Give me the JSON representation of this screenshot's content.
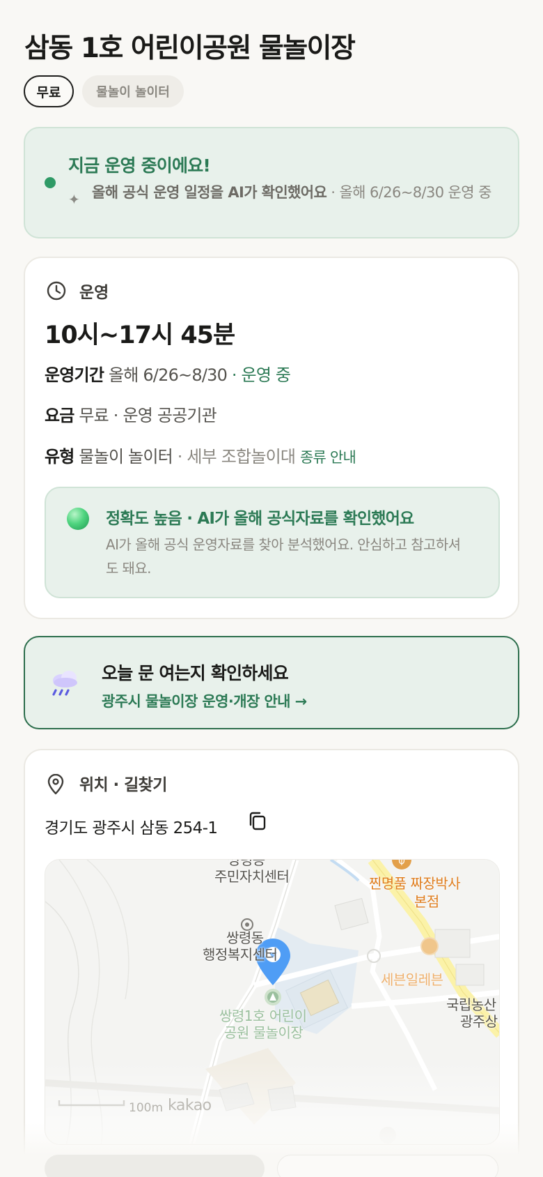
{
  "header": {
    "title": "삼동 1호 어린이공원 물놀이장"
  },
  "tags": {
    "free": "무료",
    "type": "물놀이 놀이터"
  },
  "status": {
    "title": "지금 운영 중이에요!",
    "sub_bold": "올해 공식 운영 일정을 AI가 확인했어요",
    "sub_rest": " · 올해 6/26~8/30 운영 중"
  },
  "hours": {
    "section_label": "운영",
    "time": "10시~17시 45분",
    "period_label": "운영기간",
    "period_value": " 올해 6/26~8/30",
    "period_status": " · 운영 중",
    "fee_label": "요금",
    "fee_value": " 무료 · 운영 공공기관",
    "type_label": "유형",
    "type_value": " 물놀이 놀이터",
    "type_detail": " · 세부 조합놀이대 ",
    "type_link": "종류 안내"
  },
  "accuracy": {
    "title": "정확도 높음 · AI가 올해 공식자료를 확인했어요",
    "desc": "AI가 올해 공식 운영자료를 찾아 분석했어요. 안심하고 참고하셔도 돼요."
  },
  "notice": {
    "title": "오늘 문 여는지 확인하세요",
    "link": "광주시 물놀이장 운영·개장 안내 →"
  },
  "location": {
    "section_label": "위치 · 길찾기",
    "address": "경기도 광주시 삼동 254-1"
  },
  "map": {
    "labels": {
      "community_center_top": "쌍령동",
      "community_center": "주민자치센터",
      "restaurant": "찐명품 짜장박사",
      "restaurant_sub": "본점",
      "admin_center": "쌍령동",
      "admin_center_sub": "행정복지센터",
      "store": "세븐일레븐",
      "national_1": "국립농산",
      "national_2": "광주상",
      "park": "쌍령1호 어린이",
      "park_sub": "공원 물놀이장"
    },
    "scale": "100m",
    "brand": "kakao"
  },
  "colors": {
    "accent_green": "#2c7a55",
    "status_bg": "#e8f1eb",
    "pin_blue": "#4f9df5",
    "poi_orange": "#e07e1f"
  },
  "icons": {
    "clock": "clock-icon",
    "pin": "location-pin-icon",
    "copy": "copy-icon",
    "rain": "rain-cloud-icon",
    "sparkle": "sparkle-icon"
  }
}
